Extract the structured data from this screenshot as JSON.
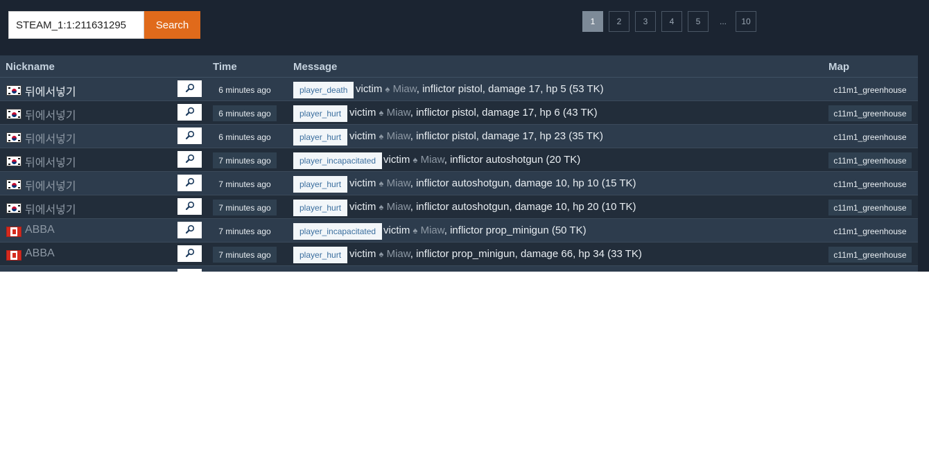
{
  "search": {
    "value": "STEAM_1:1:211631295",
    "button": "Search"
  },
  "pagination": {
    "pages": [
      "1",
      "2",
      "3",
      "4",
      "5",
      "...",
      "10"
    ],
    "active": "1"
  },
  "columns": {
    "nickname": "Nickname",
    "time": "Time",
    "message": "Message",
    "map": "Map"
  },
  "rows": [
    {
      "flag": "kr",
      "nickname": "뒤에서넣기",
      "highlight": true,
      "time": "6 minutes ago",
      "event": "player_death",
      "victim_prefix": "victim",
      "victim": "Miaw",
      "details": ", inflictor pistol, damage 17, hp 5 (53 TK)",
      "map": "c11m1_greenhouse"
    },
    {
      "flag": "kr",
      "nickname": "뒤에서넣기",
      "highlight": false,
      "time": "6 minutes ago",
      "event": "player_hurt",
      "victim_prefix": "victim",
      "victim": "Miaw",
      "details": ", inflictor pistol, damage 17, hp 6 (43 TK)",
      "map": "c11m1_greenhouse"
    },
    {
      "flag": "kr",
      "nickname": "뒤에서넣기",
      "highlight": false,
      "time": "6 minutes ago",
      "event": "player_hurt",
      "victim_prefix": "victim",
      "victim": "Miaw",
      "details": ", inflictor pistol, damage 17, hp 23 (35 TK)",
      "map": "c11m1_greenhouse"
    },
    {
      "flag": "kr",
      "nickname": "뒤에서넣기",
      "highlight": false,
      "time": "7 minutes ago",
      "event": "player_incapacitated",
      "victim_prefix": "victim",
      "victim": "Miaw",
      "details": ", inflictor autoshotgun (20 TK)",
      "map": "c11m1_greenhouse"
    },
    {
      "flag": "kr",
      "nickname": "뒤에서넣기",
      "highlight": false,
      "time": "7 minutes ago",
      "event": "player_hurt",
      "victim_prefix": "victim",
      "victim": "Miaw",
      "details": ", inflictor autoshotgun, damage 10, hp 10 (15 TK)",
      "map": "c11m1_greenhouse"
    },
    {
      "flag": "kr",
      "nickname": "뒤에서넣기",
      "highlight": false,
      "time": "7 minutes ago",
      "event": "player_hurt",
      "victim_prefix": "victim",
      "victim": "Miaw",
      "details": ", inflictor autoshotgun, damage 10, hp 20 (10 TK)",
      "map": "c11m1_greenhouse"
    },
    {
      "flag": "ca",
      "nickname": "ABBA",
      "highlight": false,
      "time": "7 minutes ago",
      "event": "player_incapacitated",
      "victim_prefix": "victim",
      "victim": "Miaw",
      "details": ", inflictor prop_minigun (50 TK)",
      "map": "c11m1_greenhouse"
    },
    {
      "flag": "ca",
      "nickname": "ABBA",
      "highlight": false,
      "time": "7 minutes ago",
      "event": "player_hurt",
      "victim_prefix": "victim",
      "victim": "Miaw",
      "details": ", inflictor prop_minigun, damage 66, hp 34 (33 TK)",
      "map": "c11m1_greenhouse"
    }
  ],
  "icons": {
    "lookup": "magnifier-icon",
    "victim_marker": "spade-icon"
  },
  "colors": {
    "accent": "#e06a1b",
    "background": "#1b2431",
    "tag_text": "#3a6e9e"
  }
}
